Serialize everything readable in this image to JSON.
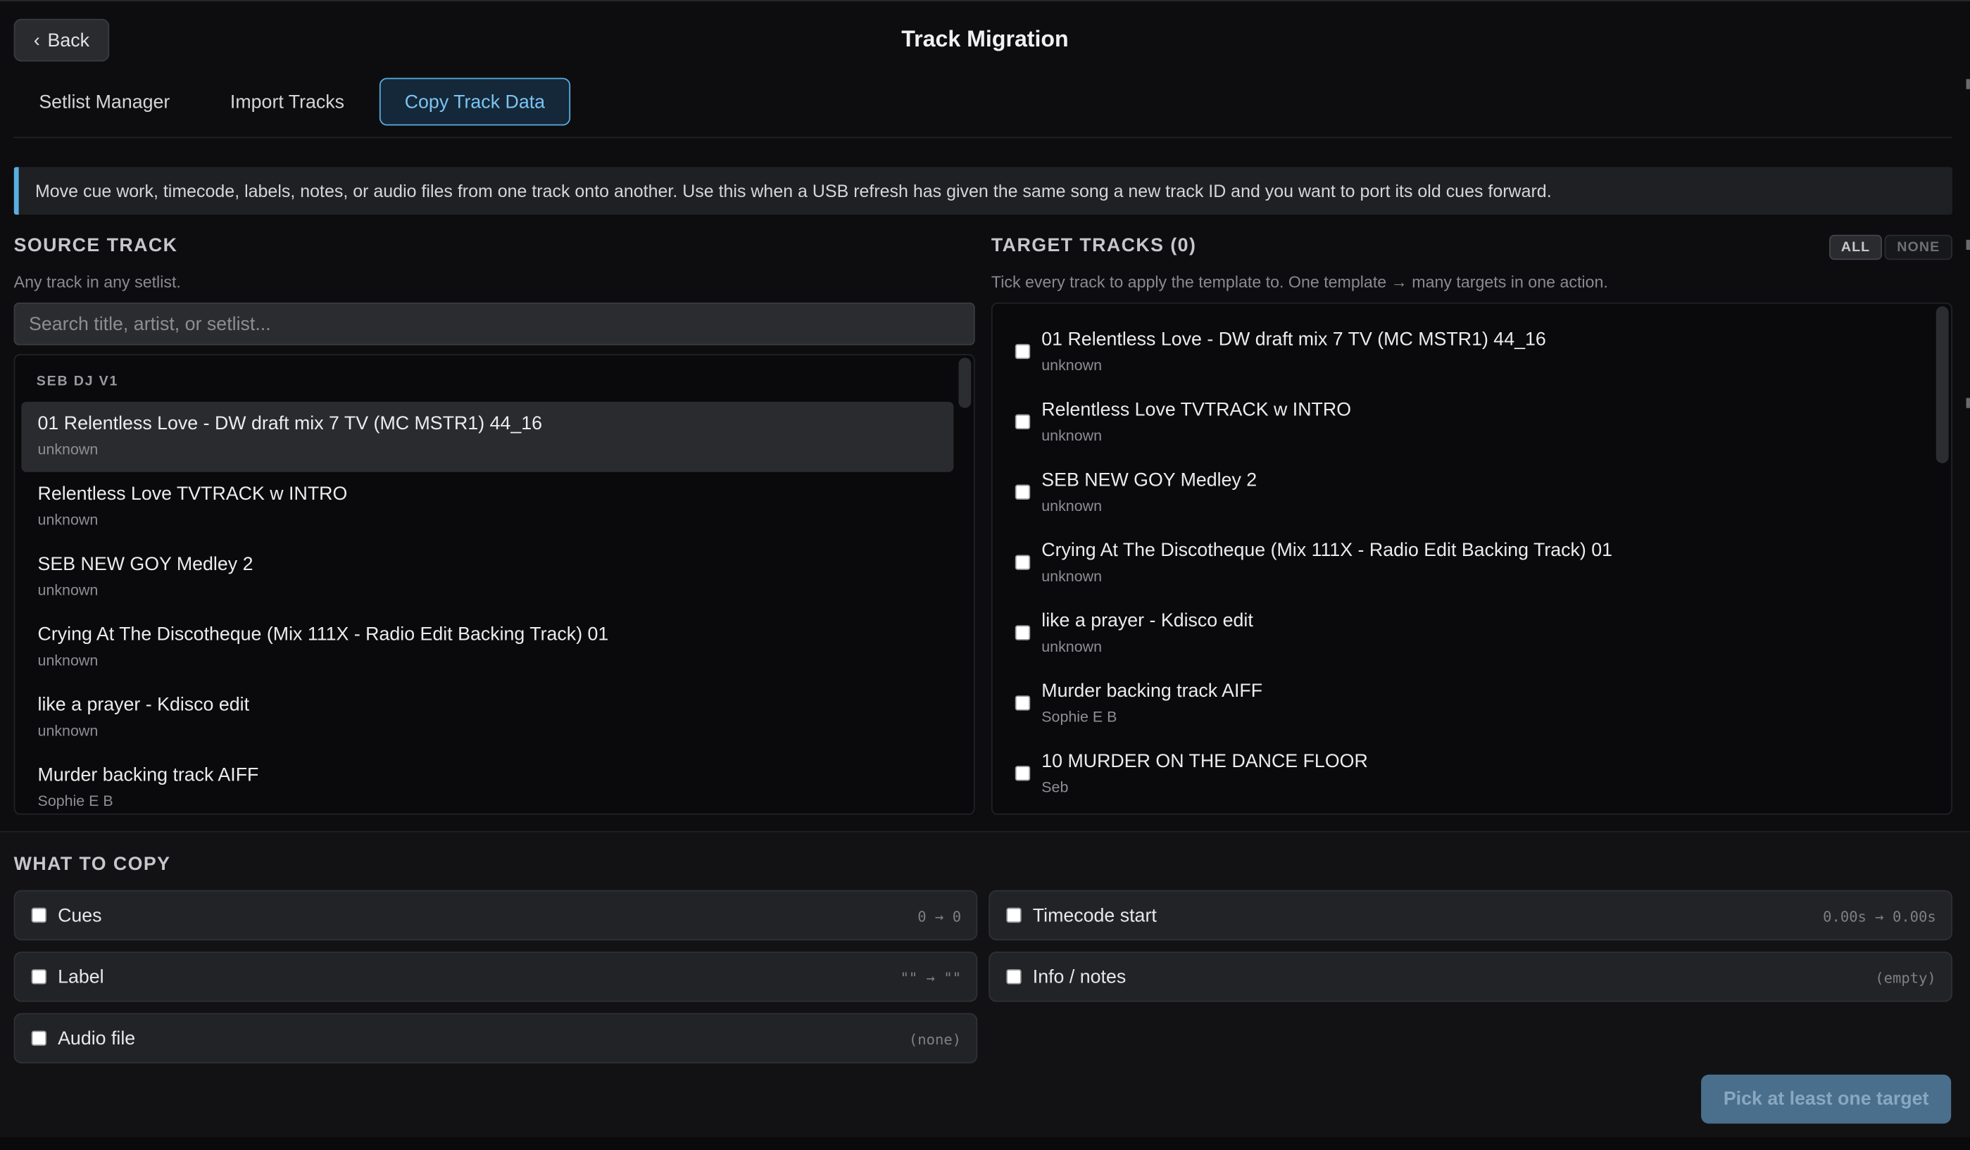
{
  "header": {
    "back_label": "Back",
    "title": "Track Migration"
  },
  "tabs": [
    {
      "label": "Setlist Manager",
      "active": false
    },
    {
      "label": "Import Tracks",
      "active": false
    },
    {
      "label": "Copy Track Data",
      "active": true
    }
  ],
  "info_banner": "Move cue work, timecode, labels, notes, or audio files from one track onto another. Use this when a USB refresh has given the same song a new track ID and you want to port its old cues forward.",
  "source": {
    "title": "SOURCE TRACK",
    "hint": "Any track in any setlist.",
    "search_placeholder": "Search title, artist, or setlist...",
    "group_label": "SEB DJ V1",
    "tracks": [
      {
        "title": "01 Relentless Love - DW draft mix 7 TV (MC MSTR1) 44_16",
        "artist": "unknown",
        "selected": true
      },
      {
        "title": "Relentless Love TVTRACK w INTRO",
        "artist": "unknown"
      },
      {
        "title": "SEB NEW GOY Medley 2",
        "artist": "unknown"
      },
      {
        "title": "Crying At The Discotheque (Mix 111X - Radio Edit Backing Track) 01",
        "artist": "unknown"
      },
      {
        "title": "like a prayer - Kdisco edit",
        "artist": "unknown"
      },
      {
        "title": "Murder backing track AIFF",
        "artist": "Sophie E B"
      }
    ]
  },
  "target": {
    "title": "TARGET TRACKS (0)",
    "hint": "Tick every track to apply the template to. One template → many targets in one action.",
    "all_label": "ALL",
    "none_label": "NONE",
    "tracks": [
      {
        "title": "01 Relentless Love - DW draft mix 7 TV (MC MSTR1) 44_16",
        "artist": "unknown"
      },
      {
        "title": "Relentless Love TVTRACK w INTRO",
        "artist": "unknown"
      },
      {
        "title": "SEB NEW GOY Medley 2",
        "artist": "unknown"
      },
      {
        "title": "Crying At The Discotheque (Mix 111X - Radio Edit Backing Track) 01",
        "artist": "unknown"
      },
      {
        "title": "like a prayer - Kdisco edit",
        "artist": "unknown"
      },
      {
        "title": "Murder backing track AIFF",
        "artist": "Sophie E B"
      },
      {
        "title": "10 MURDER ON THE DANCE FLOOR",
        "artist": "Seb"
      }
    ]
  },
  "what_to_copy": {
    "title": "WHAT TO COPY",
    "options": [
      {
        "label": "Cues",
        "value": "0 → 0"
      },
      {
        "label": "Timecode start",
        "value": "0.00s → 0.00s"
      },
      {
        "label": "Label",
        "value": "\"\" → \"\""
      },
      {
        "label": "Info / notes",
        "value": "(empty)"
      },
      {
        "label": "Audio file",
        "value": "(none)"
      }
    ]
  },
  "submit_label": "Pick at least one target"
}
